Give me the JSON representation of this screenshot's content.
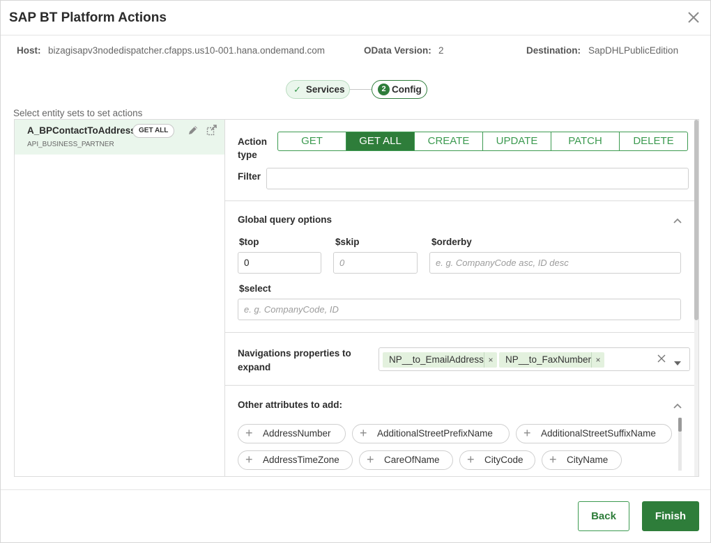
{
  "dialog": {
    "title": "SAP BT Platform Actions"
  },
  "info": {
    "host_label": "Host:",
    "host_value": "bizagisapv3nodedispatcher.cfapps.us10-001.hana.ondemand.com",
    "odata_label": "OData Version:",
    "odata_value": "2",
    "dest_label": "Destination:",
    "dest_value": "SapDHLPublicEdition"
  },
  "steps": [
    {
      "label": "Services",
      "state": "done"
    },
    {
      "number": "2",
      "label": "Config",
      "state": "active"
    }
  ],
  "entity_caption": "Select entity sets to set actions",
  "entity": {
    "name": "A_BPContactToAddress",
    "badge": "GET ALL",
    "sub": "API_BUSINESS_PARTNER"
  },
  "action_type": {
    "label_line1": "Action",
    "label_line2": "type",
    "options": [
      "GET",
      "GET ALL",
      "CREATE",
      "UPDATE",
      "PATCH",
      "DELETE"
    ],
    "selected": "GET ALL"
  },
  "filter": {
    "label": "Filter",
    "value": ""
  },
  "query": {
    "section_title": "Global query options",
    "top_label": "$top",
    "top_value": "0",
    "skip_label": "$skip",
    "skip_placeholder": "0",
    "orderby_label": "$orderby",
    "orderby_placeholder": "e. g. CompanyCode asc, ID desc",
    "select_label": "$select",
    "select_placeholder": "e. g. CompanyCode, ID"
  },
  "navigation": {
    "label_line1": "Navigations properties to",
    "label_line2": "expand",
    "tags": [
      "NP__to_EmailAddress",
      "NP__to_FaxNumber"
    ]
  },
  "other_attributes": {
    "title": "Other attributes to add:",
    "items": [
      "AddressNumber",
      "AdditionalStreetPrefixName",
      "AdditionalStreetSuffixName",
      "AddressTimeZone",
      "CareOfName",
      "CityCode",
      "CityName"
    ]
  },
  "footer": {
    "back_label": "Back",
    "finish_label": "Finish"
  },
  "colors": {
    "accent": "#2e7d3a",
    "accent_light": "#eaf6ec",
    "tag_bg": "#e3f1de"
  }
}
